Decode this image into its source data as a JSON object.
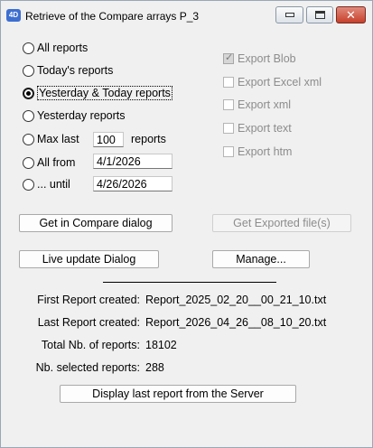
{
  "window": {
    "app_icon": "4D",
    "title": "Retrieve of the Compare arrays  P_3",
    "controls": [
      "minimize-icon",
      "maximize-icon",
      "close-icon"
    ],
    "close_glyph": "✕",
    "close_color": "#c7402b"
  },
  "radios": [
    {
      "label": "All reports",
      "checked": false
    },
    {
      "label": "Today's reports",
      "checked": false
    },
    {
      "label": "Yesterday & Today reports",
      "checked": true
    },
    {
      "label": "Yesterday reports",
      "checked": false
    },
    {
      "label": "Max last",
      "checked": false
    },
    {
      "label": "All from",
      "checked": false
    },
    {
      "label": "... until",
      "checked": false
    }
  ],
  "max_last": {
    "value": "100",
    "suffix": "reports"
  },
  "from_date": "4/1/2026",
  "until_date": "4/26/2026",
  "exports": [
    {
      "label": "Export Blob",
      "checked": true,
      "enabled": false
    },
    {
      "label": "Export Excel xml",
      "checked": false,
      "enabled": false
    },
    {
      "label": "Export xml",
      "checked": false,
      "enabled": false
    },
    {
      "label": "Export text",
      "checked": false,
      "enabled": false
    },
    {
      "label": "Export htm",
      "checked": false,
      "enabled": false
    }
  ],
  "buttons": {
    "get_in_compare": "Get in Compare dialog",
    "get_exported": "Get Exported file(s)",
    "live_update": "Live update Dialog",
    "manage": "Manage...",
    "display_last": "Display last report from the Server"
  },
  "info": {
    "first_label": "First Report created:",
    "first_value": "Report_2025_02_20__00_21_10.txt",
    "last_label": "Last Report created:",
    "last_value": "Report_2026_04_26__08_10_20.txt",
    "total_label": "Total Nb. of reports:",
    "total_value": "18102",
    "selected_label": "Nb. selected reports:",
    "selected_value": "288"
  }
}
